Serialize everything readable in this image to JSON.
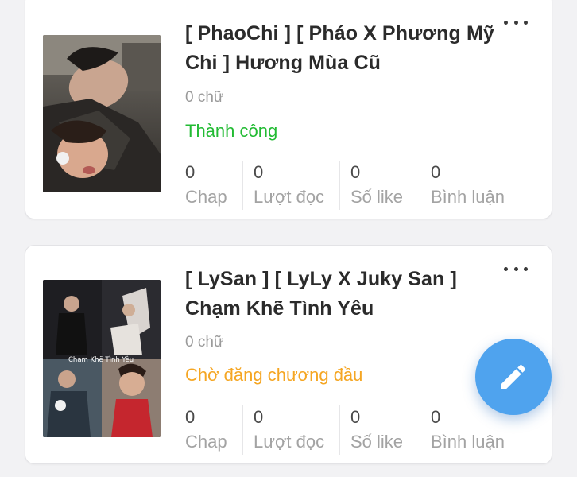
{
  "stories": [
    {
      "title": "[ PhaoChi ] [ Pháo X Phương Mỹ Chi ] Hương Mùa Cũ",
      "word_count": "0 chữ",
      "status": "Thành công",
      "status_color": "#22bb33",
      "stats": [
        {
          "value": "0",
          "label": "Chap"
        },
        {
          "value": "0",
          "label": "Lượt đọc"
        },
        {
          "value": "0",
          "label": "Số like"
        },
        {
          "value": "0",
          "label": "Bình luận"
        }
      ]
    },
    {
      "title": "[ LySan ] [ LyLy X Juky San ] Chạm Khẽ Tình Yêu",
      "word_count": "0 chữ",
      "status": "Chờ đăng chương đầu",
      "status_color": "#f5a623",
      "stats": [
        {
          "value": "0",
          "label": "Chap"
        },
        {
          "value": "0",
          "label": "Lượt đọc"
        },
        {
          "value": "0",
          "label": "Số like"
        },
        {
          "value": "0",
          "label": "Bình luận"
        }
      ]
    }
  ],
  "covers": [
    {
      "overlay_text": ""
    },
    {
      "overlay_text": "Chạm Khẽ Tình Yêu"
    }
  ],
  "fab": {
    "icon": "pencil-icon",
    "color": "#4fa3ee"
  }
}
